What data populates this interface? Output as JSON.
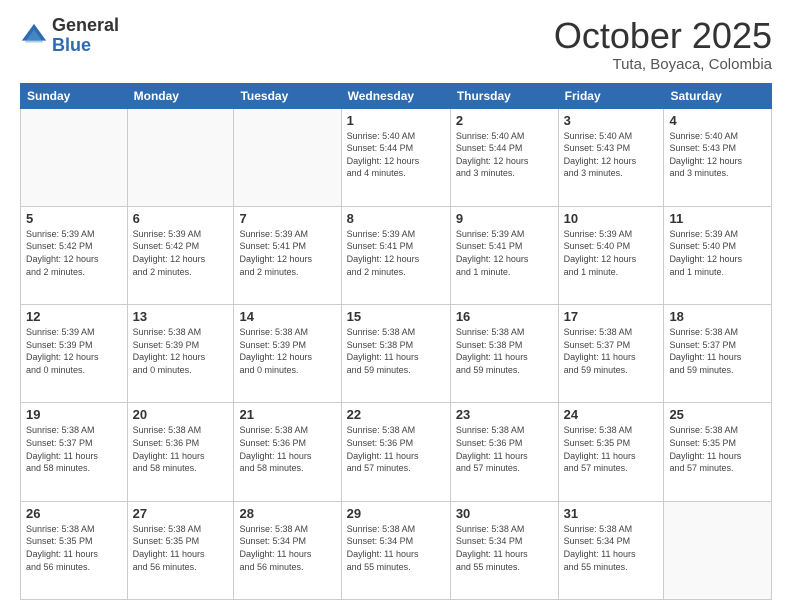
{
  "logo": {
    "general": "General",
    "blue": "Blue"
  },
  "header": {
    "month": "October 2025",
    "location": "Tuta, Boyaca, Colombia"
  },
  "weekdays": [
    "Sunday",
    "Monday",
    "Tuesday",
    "Wednesday",
    "Thursday",
    "Friday",
    "Saturday"
  ],
  "weeks": [
    [
      {
        "day": "",
        "info": ""
      },
      {
        "day": "",
        "info": ""
      },
      {
        "day": "",
        "info": ""
      },
      {
        "day": "1",
        "info": "Sunrise: 5:40 AM\nSunset: 5:44 PM\nDaylight: 12 hours\nand 4 minutes."
      },
      {
        "day": "2",
        "info": "Sunrise: 5:40 AM\nSunset: 5:44 PM\nDaylight: 12 hours\nand 3 minutes."
      },
      {
        "day": "3",
        "info": "Sunrise: 5:40 AM\nSunset: 5:43 PM\nDaylight: 12 hours\nand 3 minutes."
      },
      {
        "day": "4",
        "info": "Sunrise: 5:40 AM\nSunset: 5:43 PM\nDaylight: 12 hours\nand 3 minutes."
      }
    ],
    [
      {
        "day": "5",
        "info": "Sunrise: 5:39 AM\nSunset: 5:42 PM\nDaylight: 12 hours\nand 2 minutes."
      },
      {
        "day": "6",
        "info": "Sunrise: 5:39 AM\nSunset: 5:42 PM\nDaylight: 12 hours\nand 2 minutes."
      },
      {
        "day": "7",
        "info": "Sunrise: 5:39 AM\nSunset: 5:41 PM\nDaylight: 12 hours\nand 2 minutes."
      },
      {
        "day": "8",
        "info": "Sunrise: 5:39 AM\nSunset: 5:41 PM\nDaylight: 12 hours\nand 2 minutes."
      },
      {
        "day": "9",
        "info": "Sunrise: 5:39 AM\nSunset: 5:41 PM\nDaylight: 12 hours\nand 1 minute."
      },
      {
        "day": "10",
        "info": "Sunrise: 5:39 AM\nSunset: 5:40 PM\nDaylight: 12 hours\nand 1 minute."
      },
      {
        "day": "11",
        "info": "Sunrise: 5:39 AM\nSunset: 5:40 PM\nDaylight: 12 hours\nand 1 minute."
      }
    ],
    [
      {
        "day": "12",
        "info": "Sunrise: 5:39 AM\nSunset: 5:39 PM\nDaylight: 12 hours\nand 0 minutes."
      },
      {
        "day": "13",
        "info": "Sunrise: 5:38 AM\nSunset: 5:39 PM\nDaylight: 12 hours\nand 0 minutes."
      },
      {
        "day": "14",
        "info": "Sunrise: 5:38 AM\nSunset: 5:39 PM\nDaylight: 12 hours\nand 0 minutes."
      },
      {
        "day": "15",
        "info": "Sunrise: 5:38 AM\nSunset: 5:38 PM\nDaylight: 11 hours\nand 59 minutes."
      },
      {
        "day": "16",
        "info": "Sunrise: 5:38 AM\nSunset: 5:38 PM\nDaylight: 11 hours\nand 59 minutes."
      },
      {
        "day": "17",
        "info": "Sunrise: 5:38 AM\nSunset: 5:37 PM\nDaylight: 11 hours\nand 59 minutes."
      },
      {
        "day": "18",
        "info": "Sunrise: 5:38 AM\nSunset: 5:37 PM\nDaylight: 11 hours\nand 59 minutes."
      }
    ],
    [
      {
        "day": "19",
        "info": "Sunrise: 5:38 AM\nSunset: 5:37 PM\nDaylight: 11 hours\nand 58 minutes."
      },
      {
        "day": "20",
        "info": "Sunrise: 5:38 AM\nSunset: 5:36 PM\nDaylight: 11 hours\nand 58 minutes."
      },
      {
        "day": "21",
        "info": "Sunrise: 5:38 AM\nSunset: 5:36 PM\nDaylight: 11 hours\nand 58 minutes."
      },
      {
        "day": "22",
        "info": "Sunrise: 5:38 AM\nSunset: 5:36 PM\nDaylight: 11 hours\nand 57 minutes."
      },
      {
        "day": "23",
        "info": "Sunrise: 5:38 AM\nSunset: 5:36 PM\nDaylight: 11 hours\nand 57 minutes."
      },
      {
        "day": "24",
        "info": "Sunrise: 5:38 AM\nSunset: 5:35 PM\nDaylight: 11 hours\nand 57 minutes."
      },
      {
        "day": "25",
        "info": "Sunrise: 5:38 AM\nSunset: 5:35 PM\nDaylight: 11 hours\nand 57 minutes."
      }
    ],
    [
      {
        "day": "26",
        "info": "Sunrise: 5:38 AM\nSunset: 5:35 PM\nDaylight: 11 hours\nand 56 minutes."
      },
      {
        "day": "27",
        "info": "Sunrise: 5:38 AM\nSunset: 5:35 PM\nDaylight: 11 hours\nand 56 minutes."
      },
      {
        "day": "28",
        "info": "Sunrise: 5:38 AM\nSunset: 5:34 PM\nDaylight: 11 hours\nand 56 minutes."
      },
      {
        "day": "29",
        "info": "Sunrise: 5:38 AM\nSunset: 5:34 PM\nDaylight: 11 hours\nand 55 minutes."
      },
      {
        "day": "30",
        "info": "Sunrise: 5:38 AM\nSunset: 5:34 PM\nDaylight: 11 hours\nand 55 minutes."
      },
      {
        "day": "31",
        "info": "Sunrise: 5:38 AM\nSunset: 5:34 PM\nDaylight: 11 hours\nand 55 minutes."
      },
      {
        "day": "",
        "info": ""
      }
    ]
  ]
}
